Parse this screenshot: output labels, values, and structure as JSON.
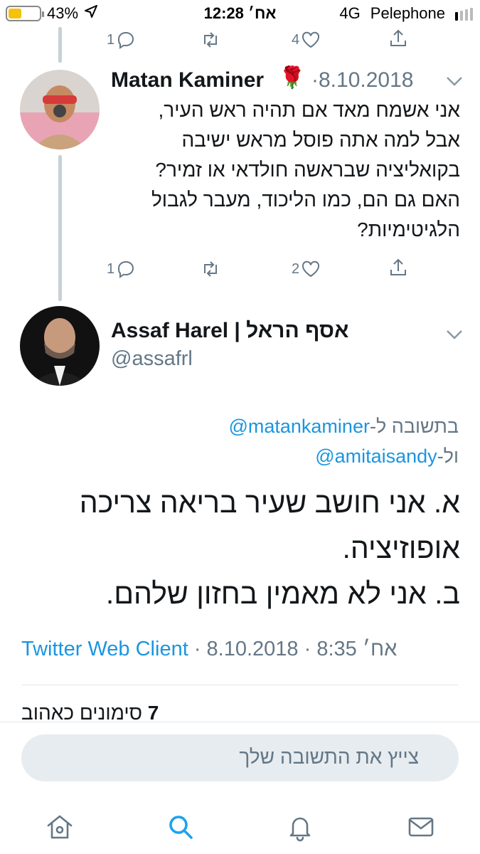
{
  "status_bar": {
    "battery": "43%",
    "battery_level": 0.43,
    "time": "12:28 אח׳",
    "network": "4G",
    "carrier": "Pelephone"
  },
  "top_actions": {
    "reply_count": "1",
    "like_count": "4"
  },
  "reply_tweet": {
    "author": "Matan Kaminer",
    "author_emoji": "🌹",
    "date": "·8.10.2018",
    "lines": [
      "אני אשמח מאד אם תהיה ראש העיר,",
      "אבל למה אתה פוסל מראש ישיבה",
      "בקואליציה שבראשה חולדאי או זמיר?",
      "האם גם הם, כמו הליכוד, מעבר לגבול",
      "הלגיטימיות?"
    ],
    "reply_count": "1",
    "like_count": "2"
  },
  "main_tweet": {
    "author": "Assaf Harel | אסף הראל",
    "handle": "@assafrl",
    "reply_prefix_1": "בתשובה ל-",
    "reply_user_1": "@matankaminer",
    "reply_prefix_2": "ול-",
    "reply_user_2": "@amitaisandy",
    "lines": [
      "א. אני חושב שעיר בריאה צריכה",
      "אופוזיציה.",
      "ב. אני לא מאמין בחזון שלהם."
    ],
    "source": "Twitter Web Client",
    "date_time": " · 8.10.2018 · אח׳ 8:35",
    "likes_count": "7",
    "likes_label": "סימונים כאהוב"
  },
  "composer": {
    "placeholder": "צייץ את התשובה שלך"
  },
  "tabs": [
    "home-icon",
    "search-icon",
    "bell-icon",
    "mail-icon"
  ],
  "colors": {
    "accent": "#1da1f2",
    "link": "#1b95e0",
    "muted": "#657786",
    "rose": "#c8102e"
  }
}
